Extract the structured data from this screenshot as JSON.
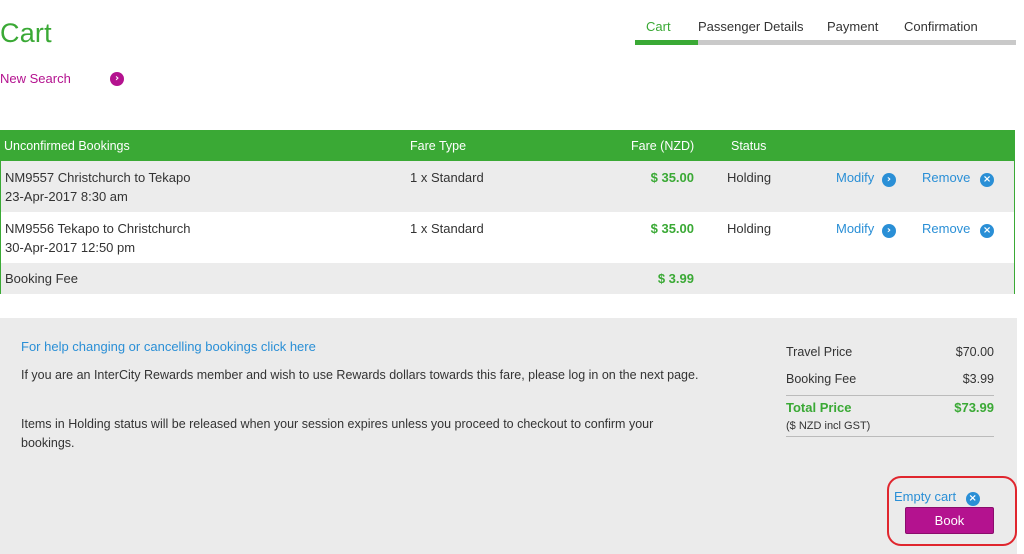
{
  "page": {
    "title": "Cart"
  },
  "new_search": {
    "label": "New Search"
  },
  "steps": [
    {
      "label": "Cart",
      "active": true
    },
    {
      "label": "Passenger Details",
      "active": false
    },
    {
      "label": "Payment",
      "active": false
    },
    {
      "label": "Confirmation",
      "active": false
    }
  ],
  "table": {
    "headers": {
      "bookings": "Unconfirmed Bookings",
      "fare_type": "Fare Type",
      "fare": "Fare (NZD)",
      "status": "Status"
    },
    "rows": [
      {
        "route": "NM9557 Christchurch to Tekapo",
        "datetime": "23-Apr-2017 8:30 am",
        "fare_type": "1 x Standard",
        "fare": "$ 35.00",
        "status": "Holding",
        "modify": "Modify",
        "remove": "Remove"
      },
      {
        "route": "NM9556 Tekapo to Christchurch",
        "datetime": "30-Apr-2017 12:50 pm",
        "fare_type": "1 x Standard",
        "fare": "$ 35.00",
        "status": "Holding",
        "modify": "Modify",
        "remove": "Remove"
      }
    ],
    "booking_fee": {
      "label": "Booking Fee",
      "amount": "$ 3.99"
    }
  },
  "info": {
    "help_link": "For help changing or cancelling bookings click here",
    "rewards_note": "If you are an InterCity Rewards member and wish to use Rewards dollars towards this fare, please log in on the next page.",
    "holding_note": "Items in Holding status will be released when your session expires unless you proceed to checkout to confirm your bookings."
  },
  "summary": {
    "travel_price_label": "Travel Price",
    "travel_price": "$70.00",
    "booking_fee_label": "Booking Fee",
    "booking_fee": "$3.99",
    "total_label": "Total Price",
    "total": "$73.99",
    "currency_note": "($ NZD incl GST)"
  },
  "actions": {
    "empty_cart": "Empty cart",
    "book": "Book"
  },
  "icons": {
    "arrow": "›",
    "remove": "×"
  },
  "colors": {
    "green": "#3aa935",
    "magenta": "#b4128f",
    "blue": "#2a8fd6",
    "highlight": "#e0262e"
  }
}
